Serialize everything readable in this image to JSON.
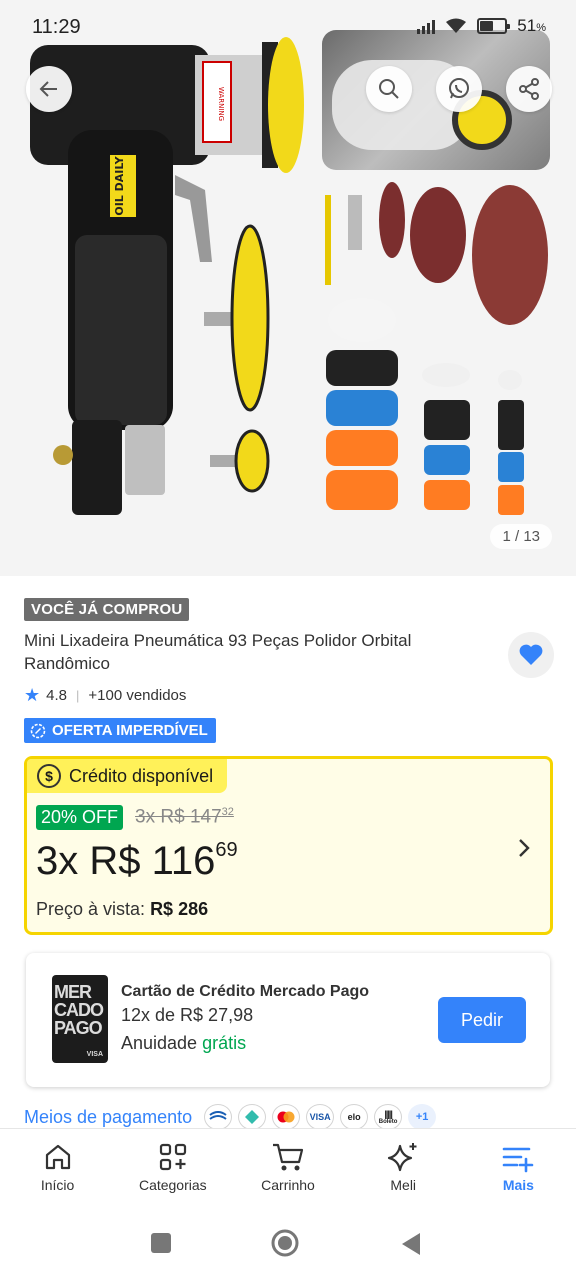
{
  "status_bar": {
    "time": "11:29",
    "battery": "51",
    "battery_level": 0.51
  },
  "gallery": {
    "counter": "1 / 13",
    "product_text": "OIL DAILY",
    "warning_text": "WARNING"
  },
  "product": {
    "bought_badge": "VOCÊ JÁ COMPROU",
    "title": "Mini Lixadeira Pneumática 93 Peças Polidor Orbital Randômico",
    "rating": "4.8",
    "sold": "+100 vendidos",
    "offer_badge": "OFERTA IMPERDÍVEL",
    "favorited": true
  },
  "credit": {
    "tag": "Crédito disponível",
    "off": "20% OFF",
    "old_price_main": "3x R$ 147",
    "old_price_cents": "32",
    "price_main": "3x R$ 116",
    "price_cents": "69",
    "cash_label": "Preço à vista:",
    "cash_value": "R$ 286"
  },
  "mp_card": {
    "title": "Cartão de Crédito Mercado Pago",
    "installments": "12x de R$ 27,98",
    "annuity_label": "Anuidade",
    "annuity_value": "grátis",
    "button": "Pedir",
    "card_brand": "VISA"
  },
  "payments": {
    "link": "Meios de pagamento",
    "more": "+1",
    "icons": [
      "caixa-icon",
      "pix-icon",
      "mastercard-icon",
      "visa-icon",
      "elo-icon",
      "boleto-icon"
    ],
    "visa": "VISA",
    "elo": "elo",
    "boleto": "Boleto"
  },
  "bottom_nav": {
    "home": "Início",
    "categories": "Categorias",
    "cart": "Carrinho",
    "meli": "Meli",
    "more": "Mais",
    "active": "more"
  },
  "colors": {
    "accent": "#3483fa",
    "credit_border": "#f5d400",
    "credit_tag": "#fff159",
    "discount_green": "#00a650"
  }
}
